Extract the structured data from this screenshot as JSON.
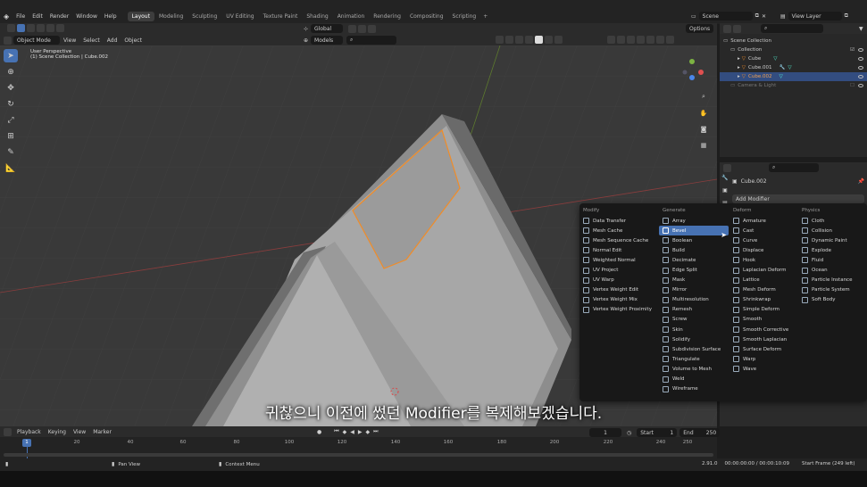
{
  "menus": [
    "File",
    "Edit",
    "Render",
    "Window",
    "Help"
  ],
  "workspaces": [
    {
      "label": "Layout",
      "active": true
    },
    {
      "label": "Modeling"
    },
    {
      "label": "Sculpting"
    },
    {
      "label": "UV Editing"
    },
    {
      "label": "Texture Paint"
    },
    {
      "label": "Shading"
    },
    {
      "label": "Animation"
    },
    {
      "label": "Rendering"
    },
    {
      "label": "Compositing"
    },
    {
      "label": "Scripting"
    }
  ],
  "scene": "Scene",
  "view_layer": "View Layer",
  "viewport_header": {
    "mode": "Object Mode",
    "menu": [
      "View",
      "Select",
      "Add",
      "Object"
    ],
    "orientation": "Global",
    "options": "Options",
    "models": "Models"
  },
  "viewport_info": {
    "perspective": "User Perspective",
    "collection": "(1) Scene Collection | Cube.002"
  },
  "outliner": {
    "rows": [
      {
        "label": "Scene Collection",
        "indent": 0
      },
      {
        "label": "Collection",
        "indent": 1
      },
      {
        "label": "Cube",
        "indent": 2
      },
      {
        "label": "Cube.001",
        "indent": 2
      },
      {
        "label": "Cube.002",
        "indent": 2,
        "selected": true
      },
      {
        "label": "Camera & Light",
        "indent": 1,
        "dim": true
      }
    ]
  },
  "properties": {
    "object_name": "Cube.002",
    "add_modifier": "Add Modifier"
  },
  "modifier_menu": {
    "columns": [
      {
        "header": "Modify",
        "items": [
          "Data Transfer",
          "Mesh Cache",
          "Mesh Sequence Cache",
          "Normal Edit",
          "Weighted Normal",
          "UV Project",
          "UV Warp",
          "Vertex Weight Edit",
          "Vertex Weight Mix",
          "Vertex Weight Proximity"
        ]
      },
      {
        "header": "Generate",
        "items": [
          "Array",
          "Bevel",
          "Boolean",
          "Build",
          "Decimate",
          "Edge Split",
          "Mask",
          "Mirror",
          "Multiresolution",
          "Remesh",
          "Screw",
          "Skin",
          "Solidify",
          "Subdivision Surface",
          "Triangulate",
          "Volume to Mesh",
          "Weld",
          "Wireframe"
        ],
        "highlighted": "Bevel"
      },
      {
        "header": "Deform",
        "items": [
          "Armature",
          "Cast",
          "Curve",
          "Displace",
          "Hook",
          "Laplacian Deform",
          "Lattice",
          "Mesh Deform",
          "Shrinkwrap",
          "Simple Deform",
          "Smooth",
          "Smooth Corrective",
          "Smooth Laplacian",
          "Surface Deform",
          "Warp",
          "Wave"
        ]
      },
      {
        "header": "Physics",
        "items": [
          "Cloth",
          "Collision",
          "Dynamic Paint",
          "Explode",
          "Fluid",
          "Ocean",
          "Particle Instance",
          "Particle System",
          "Soft Body"
        ]
      }
    ]
  },
  "timeline": {
    "menu": [
      "Playback",
      "Keying",
      "View",
      "Marker"
    ],
    "current_frame": "1",
    "start_label": "Start",
    "start": "1",
    "end_label": "End",
    "end": "250",
    "ticks": [
      "1",
      "20",
      "40",
      "60",
      "80",
      "100",
      "120",
      "140",
      "160",
      "180",
      "200",
      "220",
      "240",
      "250"
    ]
  },
  "statusbar": {
    "pan": "Pan View",
    "context": "Context Menu",
    "version": "2.91.0",
    "time": "00:00:00:00 / 00:00:10:09",
    "start_frame": "Start Frame (249 left)"
  },
  "subtitle": "귀찮으니 이전에 썼던 Modifier를 복제해보겠습니다.",
  "colors": {
    "accent": "#4772b3",
    "selection_outline": "#f08c28",
    "background": "#393939"
  }
}
